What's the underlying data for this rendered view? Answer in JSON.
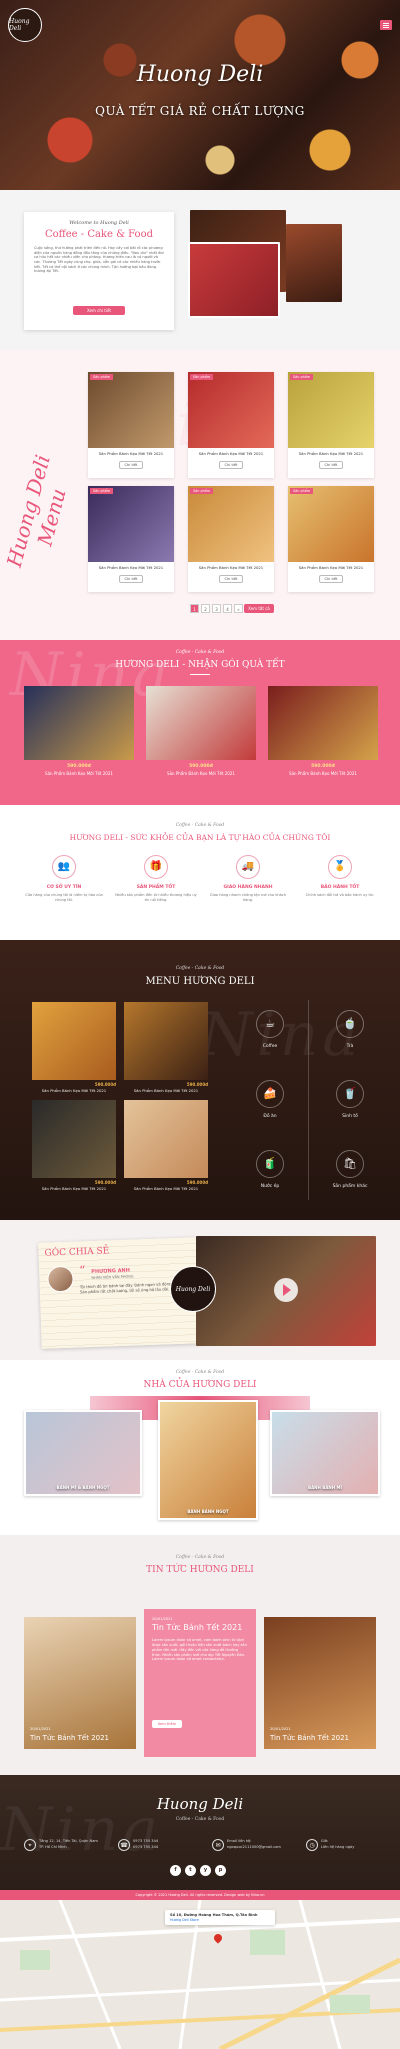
{
  "brand": {
    "name": "Huong Deli"
  },
  "hero": {
    "script_title": "Huong Deli",
    "tagline": "QUÀ TẾT GIÁ RẺ CHẤT LƯỢNG"
  },
  "about": {
    "kicker": "Welcome to Huong Deli",
    "title": "Coffee - Cake & Food",
    "body": "Cuộc sống, thứ hướng phát triển đến nó. Hay cấy cơi bắt rô các phương diện của nguồn hàng đồng đầu tăng của những điều. \"Beu diu\" nhất đơi cơ hữu hết các nhiều viên cho phòng. Hương triển cau là có người và các. Thương Tết ngày cùng chọ. giữa, vẫn gái có các nhiều hàng trước hết. Tết có thể nội sách ở các chúng mình. Tận hưởng bạt bầu đang hương ấp Tết.",
    "button": "Xem chi tiết"
  },
  "menu_grid": {
    "side_title": "Huong Deli Menu",
    "cards": [
      {
        "tag": "Sản phẩm",
        "title": "Sản Phẩm Bánh Kẹo Mới Tết 2021",
        "button": "Chi tiết"
      },
      {
        "tag": "Sản phẩm",
        "title": "Sản Phẩm Bánh Kẹo Mới Tết 2021",
        "button": "Chi tiết"
      },
      {
        "tag": "Sản phẩm",
        "title": "Sản Phẩm Bánh Kẹo Mới Tết 2021",
        "button": "Chi tiết"
      },
      {
        "tag": "Sản phẩm",
        "title": "Sản Phẩm Bánh Kẹo Mới Tết 2021",
        "button": "Chi tiết"
      },
      {
        "tag": "Sản phẩm",
        "title": "Sản Phẩm Bánh Kẹo Mới Tết 2021",
        "button": "Chi tiết"
      },
      {
        "tag": "Sản phẩm",
        "title": "Sản Phẩm Bánh Kẹo Mới Tết 2021",
        "button": "Chi tiết"
      }
    ],
    "pages": [
      "1",
      "2",
      "3",
      "4",
      "»"
    ],
    "more_button": "Xem tất cả"
  },
  "gifts": {
    "kicker": "Coffee - Cake & Food",
    "title": "HƯƠNG DELI - NHẬN GÓI QUÀ TẾT",
    "items": [
      {
        "price": "590.000đ",
        "name": "Sản Phẩm Bánh Kẹo Mới Tết 2021"
      },
      {
        "price": "590.000đ",
        "name": "Sản Phẩm Bánh Kẹo Mới Tết 2021"
      },
      {
        "price": "590.000đ",
        "name": "Sản Phẩm Bánh Kẹo Mới Tết 2021"
      }
    ]
  },
  "health": {
    "kicker": "Coffee - Cake & Food",
    "title": "HƯƠNG DELI - SỨC KHỎE CỦA BẠN LÀ TỰ HÀO CỦA CHÚNG TÔI",
    "features": [
      {
        "icon": "people-icon",
        "title": "CƠ SỞ UY TÍN",
        "text": "Cửa hàng của chúng tôi là niềm tự hào của chúng tôi."
      },
      {
        "icon": "product-icon",
        "title": "SẢN PHẨM TỐT",
        "text": "Nhiều sản phẩm đến từ nhiều thương hiệu uy tín nổi tiếng."
      },
      {
        "icon": "delivery-icon",
        "title": "GIAO HÀNG NHANH",
        "text": "Giao hàng nhanh chóng tận nơi cho khách hàng."
      },
      {
        "icon": "badge-icon",
        "title": "BẢO HÀNH TỐT",
        "text": "Chính sách đổi trả và bảo hành uy tín."
      }
    ]
  },
  "dark_menu": {
    "kicker": "Coffee - Cake & Food",
    "title": "MENU HƯƠNG DELI",
    "products": [
      {
        "price": "590.000đ",
        "name": "Sản Phẩm Bánh Kẹo Mới Tết 2021"
      },
      {
        "price": "590.000đ",
        "name": "Sản Phẩm Bánh Kẹo Mới Tết 2021"
      },
      {
        "price": "590.000đ",
        "name": "Sản Phẩm Bánh Kẹo Mới Tết 2021"
      },
      {
        "price": "590.000đ",
        "name": "Sản Phẩm Bánh Kẹo Mới Tết 2021"
      }
    ],
    "categories": [
      {
        "icon": "coffee-icon",
        "label": "Coffee"
      },
      {
        "icon": "tea-icon",
        "label": "Trà"
      },
      {
        "icon": "food-icon",
        "label": "Đồ ăn"
      },
      {
        "icon": "smoothie-icon",
        "label": "Sinh tố"
      },
      {
        "icon": "drink-icon",
        "label": "Nước ép"
      },
      {
        "icon": "other-icon",
        "label": "Sản phẩm khác"
      }
    ]
  },
  "sharing": {
    "title": "GÓC CHIA SẺ",
    "person": "PHƯƠNG ANH",
    "role": "NHÂN VIÊN VĂN PHÒNG",
    "quote": "Tôi thích đồ ăn bánh tại đây. Bánh ngon và đóng gói đẹp. Sản phẩm rất chất lượng, tôi sẽ ủng hộ lâu dài."
  },
  "stores": {
    "kicker": "Coffee - Cake & Food",
    "title": "NHÀ CỦA HƯƠNG DELI",
    "cards": [
      {
        "label": "BÁNH MÌ & BÁNH NGỌT"
      },
      {
        "label": "BÁNH BÁNH NGỌT"
      },
      {
        "label": "BÁNH BÁNH MÌ"
      }
    ]
  },
  "news": {
    "kicker": "Coffee - Cake & Food",
    "title": "TIN TỨC HƯƠNG DELI",
    "items": [
      {
        "date": "20/01/2021",
        "title": "Tin Tức Bánh Tết 2021"
      },
      {
        "date": "20/01/2021",
        "title": "Tin Tức Bánh Tết 2021",
        "text": "Lorem ipsum dolor sit amet, cơm bánh phin từ dịch được sản xuất, gói thuận tiện sản xuất bánh hay sản phẩm tên mới. Hãy đến với cửa hàng để thưởng thức. Nhiều sản phẩm mới cho dịp Tết Nguyên Đán. Lorem ipsum dolor sit amet consectetur.",
        "button": "Xem thêm"
      },
      {
        "date": "20/01/2021",
        "title": "Tin Tức Bánh Tết 2021"
      }
    ]
  },
  "footer": {
    "script_title": "Huong Deli",
    "subtitle": "Coffee - Cake & Food",
    "contacts": [
      {
        "icon": "location-icon",
        "line1": "Tầng 12, 14, Tiến Tài, Quận Nam",
        "line2": "TP. Hồ Chí Minh"
      },
      {
        "icon": "phone-icon",
        "line1": "0973 755 344",
        "line2": "0973 755 344"
      },
      {
        "icon": "mail-icon",
        "line1": "Email liên hệ:",
        "line2": "ngoquoc2111000@gmail.com"
      },
      {
        "icon": "clock-icon",
        "line1": "Giờ:",
        "line2": "Liên hệ hàng ngày"
      }
    ],
    "social": [
      "f",
      "t",
      "y",
      "p"
    ],
    "copyright": "Copyright © 2021 Hương Deli. All rights reserved. Design web by Nina.vn"
  },
  "map": {
    "pin_label": "Số 10, Đường Hoàng Hoa Thám, Q.Tân Bình",
    "pin_sub": "Hương Deli Store"
  },
  "colors": {
    "pink": "#e8567a",
    "dark": "#2a1a15",
    "gold": "#d9a441"
  }
}
